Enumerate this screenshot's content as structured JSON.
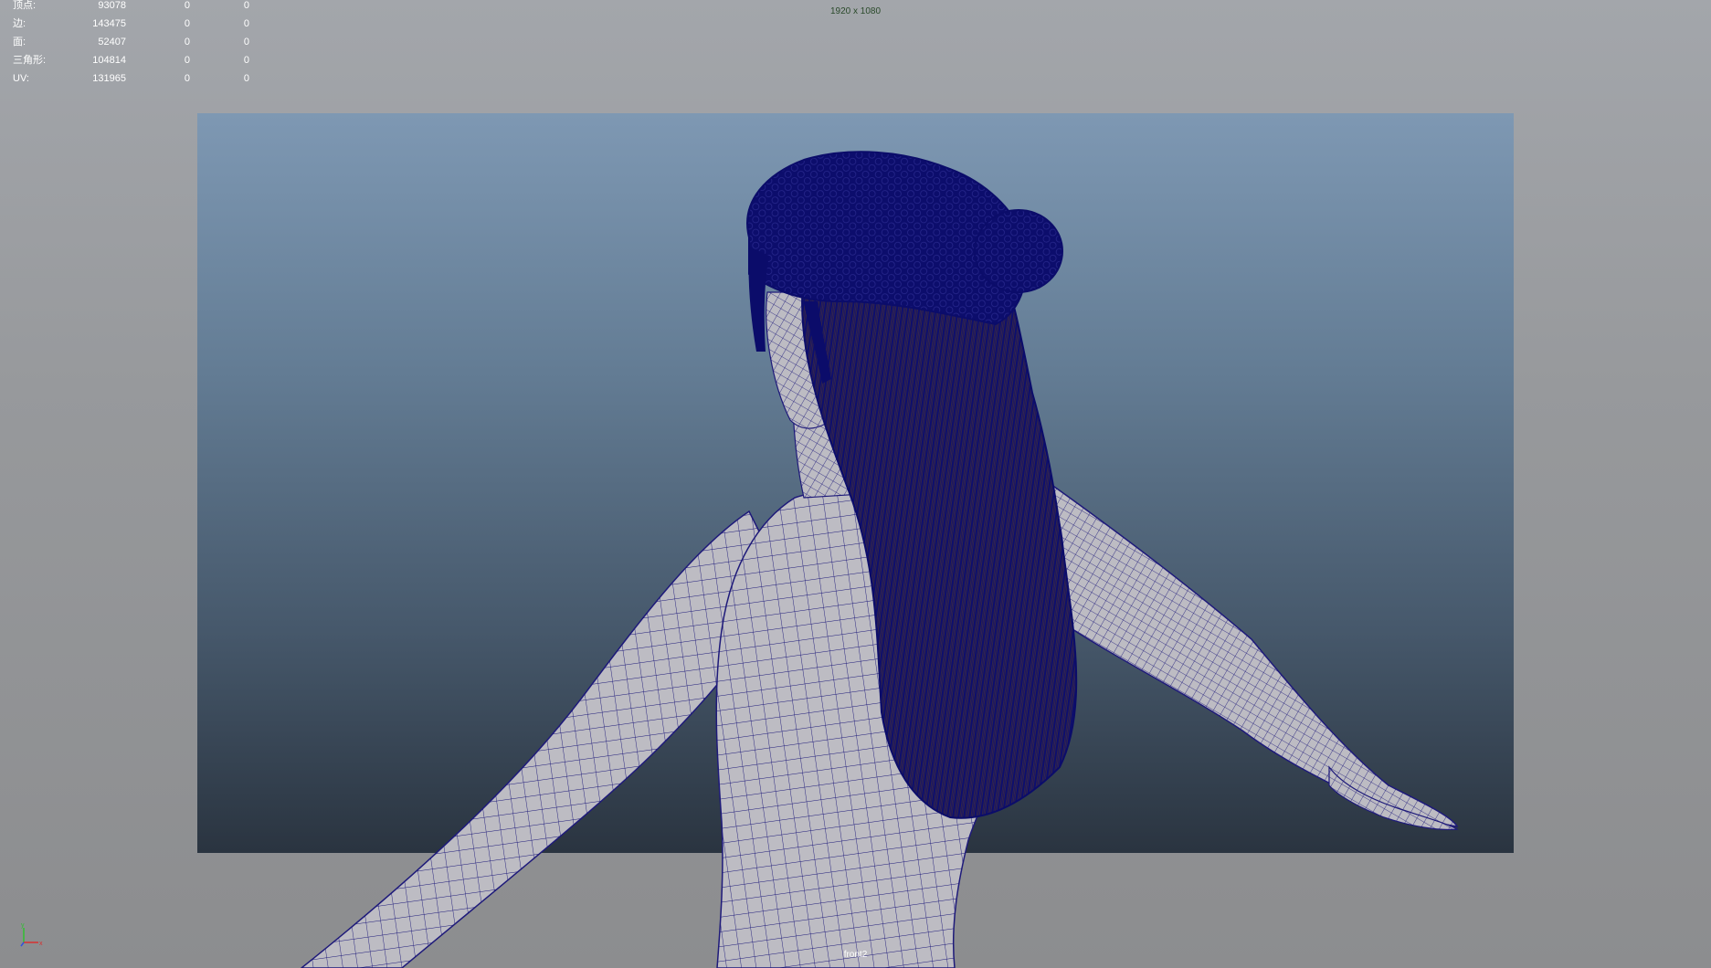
{
  "hud": {
    "rows": [
      {
        "label": "顶点:",
        "total": "93078",
        "selected": "0",
        "components": "0"
      },
      {
        "label": "边:",
        "total": "143475",
        "selected": "0",
        "components": "0"
      },
      {
        "label": "面:",
        "total": "52407",
        "selected": "0",
        "components": "0"
      },
      {
        "label": "三角形:",
        "total": "104814",
        "selected": "0",
        "components": "0"
      },
      {
        "label": "UV:",
        "total": "131965",
        "selected": "0",
        "components": "0"
      }
    ]
  },
  "viewport": {
    "resolution": "1920 x 1080",
    "camera_name": "front2"
  },
  "axis": {
    "x_label": "x",
    "y_label": "y"
  },
  "colors": {
    "viewport_bg": "#98999c",
    "gate_top": "#7e98b3",
    "gate_bottom": "#2a3440",
    "wireframe": "#1e1a7a",
    "skin": "#b9b8bf",
    "hair": "#0b0c6a",
    "axis_x": "#d83030",
    "axis_y": "#30c030",
    "axis_z": "#3050e0"
  }
}
